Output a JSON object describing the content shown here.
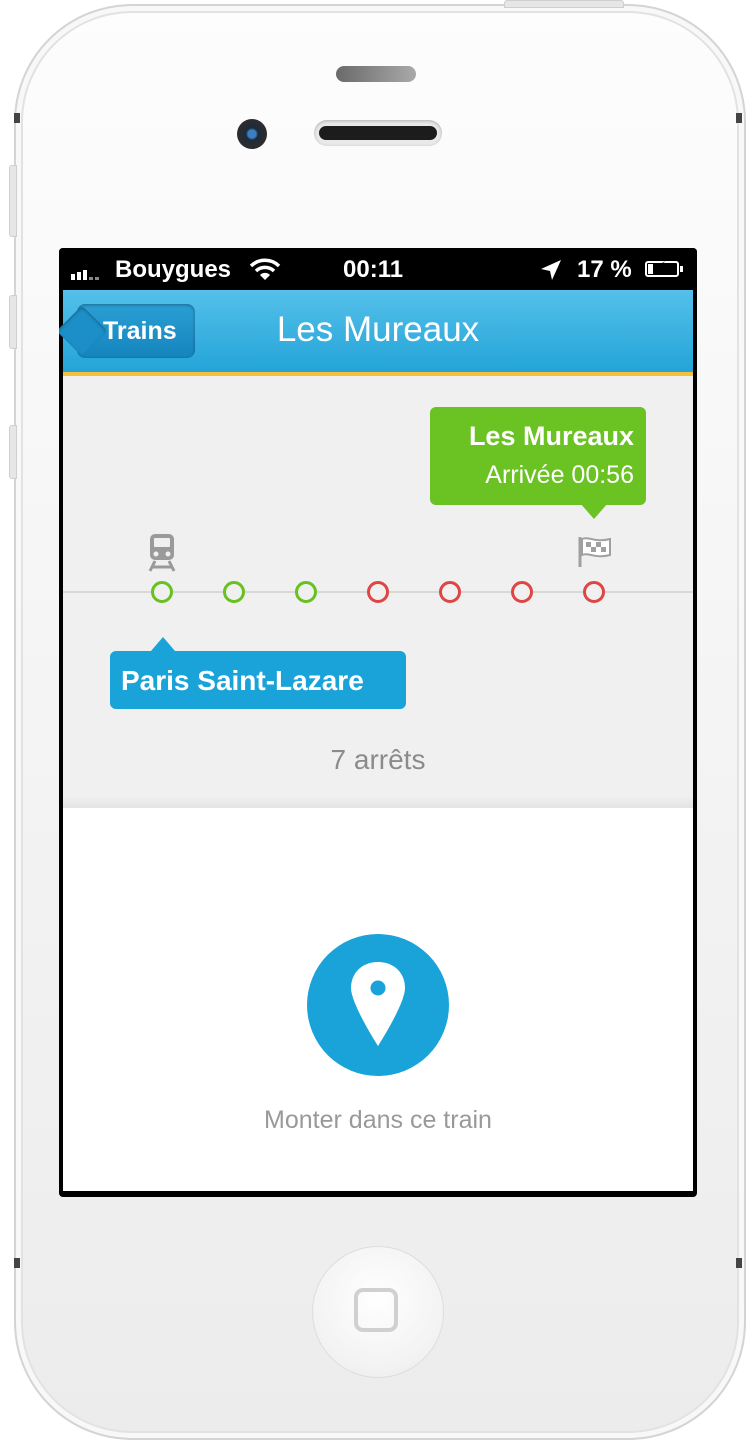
{
  "status_bar": {
    "carrier": "Bouygues",
    "time": "00:11",
    "battery": "17 %",
    "battery_level": 0.17,
    "icons": [
      "signal-icon",
      "wifi-icon",
      "location-arrow-icon",
      "battery-charging-icon"
    ]
  },
  "nav": {
    "back_label": "Trains",
    "title": "Les Mureaux"
  },
  "journey": {
    "destination": {
      "name": "Les Mureaux",
      "arrival": "Arrivée 00:56",
      "color": "#6bc223"
    },
    "origin": {
      "name": "Paris Saint-Lazare",
      "color": "#1aa3d9"
    },
    "stops": [
      {
        "status": "passed"
      },
      {
        "status": "passed"
      },
      {
        "status": "passed"
      },
      {
        "status": "upcoming"
      },
      {
        "status": "upcoming"
      },
      {
        "status": "upcoming"
      },
      {
        "status": "upcoming"
      }
    ],
    "stops_count": "7 arrêts",
    "colors": {
      "passed": "#68c11e",
      "upcoming": "#e04545"
    }
  },
  "action": {
    "label": "Monter dans ce train",
    "icon": "map-pin-icon",
    "color": "#1aa3d9"
  },
  "colors": {
    "nav_bar": "#23a4d8",
    "accent": "#f2c33a"
  }
}
